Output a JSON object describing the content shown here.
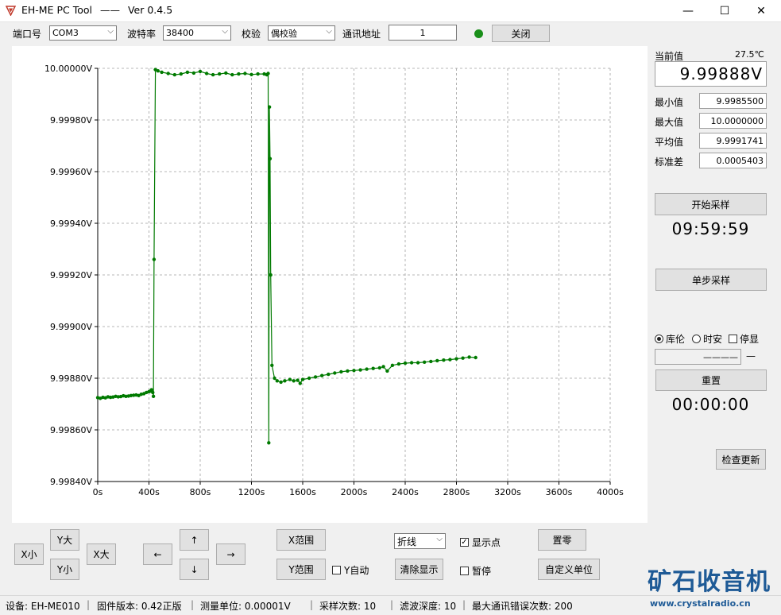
{
  "window": {
    "title": "EH-ME PC Tool",
    "separator": "——",
    "version": "Ver 0.4.5",
    "controls": {
      "minimize": "—",
      "maximize": "☐",
      "close": "✕"
    }
  },
  "toolbar": {
    "port_label": "端口号",
    "port_value": "COM3",
    "baud_label": "波特率",
    "baud_value": "38400",
    "parity_label": "校验",
    "parity_value": "偶校验",
    "addr_label": "通讯地址",
    "addr_value": "1",
    "status_color": "#1a8f1a",
    "close_button": "关闭"
  },
  "chart_data": {
    "type": "line",
    "series": [
      {
        "color": "#007a00",
        "x": [
          0,
          20,
          40,
          60,
          80,
          100,
          120,
          140,
          160,
          180,
          200,
          220,
          240,
          260,
          280,
          300,
          320,
          340,
          360,
          380,
          400,
          410,
          420,
          430,
          435,
          440,
          450,
          470,
          500,
          550,
          600,
          650,
          700,
          750,
          800,
          850,
          900,
          950,
          1000,
          1050,
          1100,
          1150,
          1200,
          1250,
          1300,
          1320,
          1330,
          1335,
          1340,
          1345,
          1350,
          1360,
          1380,
          1400,
          1430,
          1460,
          1500,
          1530,
          1560,
          1580,
          1600,
          1650,
          1700,
          1750,
          1800,
          1850,
          1900,
          1950,
          2000,
          2050,
          2100,
          2150,
          2200,
          2230,
          2260,
          2300,
          2350,
          2400,
          2450,
          2500,
          2550,
          2600,
          2650,
          2700,
          2750,
          2800,
          2850,
          2900,
          2950
        ],
        "y": [
          9.998725,
          9.998722,
          9.998726,
          9.998724,
          9.998728,
          9.998726,
          9.998727,
          9.99873,
          9.998728,
          9.998729,
          9.998732,
          9.99873,
          9.998731,
          9.998733,
          9.998734,
          9.998735,
          9.998733,
          9.998738,
          9.99874,
          9.998745,
          9.998748,
          9.99875,
          9.998755,
          9.998745,
          9.99873,
          9.99926,
          9.999995,
          9.99999,
          9.999985,
          9.99998,
          9.999975,
          9.999978,
          9.999985,
          9.999982,
          9.999988,
          9.99998,
          9.999975,
          9.999978,
          9.999982,
          9.999975,
          9.999978,
          9.99998,
          9.999976,
          9.999978,
          9.999978,
          9.999975,
          9.99998,
          9.99855,
          9.99985,
          9.99965,
          9.9992,
          9.99885,
          9.9988,
          9.99879,
          9.998785,
          9.99879,
          9.998795,
          9.99879,
          9.998792,
          9.99878,
          9.998795,
          9.9988,
          9.998805,
          9.99881,
          9.998815,
          9.99882,
          9.998825,
          9.998828,
          9.99883,
          9.998832,
          9.998835,
          9.998838,
          9.99884,
          9.998845,
          9.998828,
          9.99885,
          9.998855,
          9.998858,
          9.99886,
          9.99886,
          9.998862,
          9.998865,
          9.998868,
          9.99887,
          9.998872,
          9.998875,
          9.998878,
          9.998882,
          9.99888
        ]
      }
    ],
    "xlim": [
      0,
      4000
    ],
    "ylim": [
      9.9984,
      10.0
    ],
    "xticks": [
      "0s",
      "400s",
      "800s",
      "1200s",
      "1600s",
      "2000s",
      "2400s",
      "2800s",
      "3200s",
      "3600s",
      "4000s"
    ],
    "yticks": [
      "10.00000V",
      "9.99980V",
      "9.99960V",
      "9.99940V",
      "9.99920V",
      "9.99900V",
      "9.99880V",
      "9.99860V",
      "9.99840V"
    ],
    "grid": true
  },
  "right_panel": {
    "current_label": "当前值",
    "temperature": "27.5℃",
    "current_value": "9.99888V",
    "stats": [
      {
        "label": "最小值",
        "value": "9.9985500"
      },
      {
        "label": "最大值",
        "value": "10.0000000"
      },
      {
        "label": "平均值",
        "value": "9.9991741"
      },
      {
        "label": "标准差",
        "value": "0.0005403"
      }
    ],
    "start_button": "开始采样",
    "timer": "09:59:59",
    "single_button": "单步采样",
    "radio_coulomb": "库伦",
    "radio_ah": "时安",
    "stop_label": "停显",
    "accum_value": "————",
    "accum_unit": "—",
    "reset_button": "重置",
    "elapsed": "00:00:00",
    "update_button": "检查更新"
  },
  "bottom_controls": {
    "x_small": "X小",
    "y_large": "Y大",
    "x_large": "X大",
    "y_small": "Y小",
    "left_arrow": "←",
    "up_arrow": "↑",
    "right_arrow": "→",
    "down_arrow": "↓",
    "x_range": "X范围",
    "y_range": "Y范围",
    "y_auto": "Y自动",
    "plot_mode": "折线",
    "show_points": "显示点",
    "clear_display": "清除显示",
    "pause": "暂停",
    "zero": "置零",
    "custom_unit": "自定义单位"
  },
  "watermark": {
    "cn": "矿石收音机",
    "url": "www.crystalradio.cn"
  },
  "statusbar": {
    "device": "设备:  EH-ME010",
    "firmware": "固件版本:  0.42正版",
    "unit": "测量单位:    0.00001V",
    "samples": "采样次数:    10",
    "filter": "滤波深度:   10",
    "max_errors": "最大通讯错误次数:  200"
  }
}
